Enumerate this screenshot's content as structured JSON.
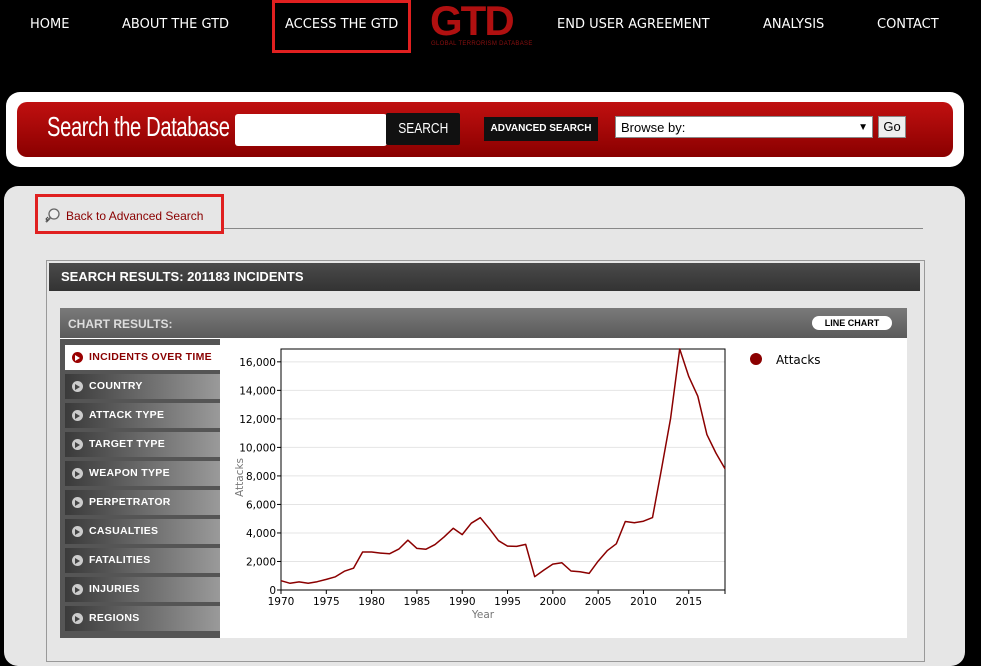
{
  "nav": {
    "items": [
      "HOME",
      "ABOUT THE GTD",
      "ACCESS THE GTD",
      "END USER AGREEMENT",
      "ANALYSIS",
      "CONTACT"
    ],
    "logo_text": "GTD",
    "logo_subtitle": "GLOBAL TERRORISM DATABASE"
  },
  "search": {
    "title": "Search the Database",
    "input_value": "",
    "search_label": "SEARCH",
    "advanced_label": "ADVANCED SEARCH",
    "browse_selected": "Browse by:",
    "go_label": "Go"
  },
  "back_link": "Back to Advanced Search",
  "results": {
    "header": "SEARCH RESULTS: 201183 INCIDENTS",
    "chart_header": "CHART RESULTS:",
    "chart_type_button": "LINE CHART",
    "categories": [
      "INCIDENTS OVER TIME",
      "COUNTRY",
      "ATTACK TYPE",
      "TARGET TYPE",
      "WEAPON TYPE",
      "PERPETRATOR",
      "CASUALTIES",
      "FATALITIES",
      "INJURIES",
      "REGIONS"
    ],
    "active_category": "INCIDENTS OVER TIME"
  },
  "colors": {
    "accent": "#8a0000",
    "line": "#8b0000",
    "nav_active_outline": "#e02020"
  },
  "chart_data": {
    "type": "line",
    "xlabel": "Year",
    "ylabel": "Attacks",
    "xlim": [
      1970,
      2019
    ],
    "ylim": [
      0,
      16900
    ],
    "xticks": [
      1970,
      1975,
      1980,
      1985,
      1990,
      1995,
      2000,
      2005,
      2010,
      2015
    ],
    "yticks": [
      0,
      2000,
      4000,
      6000,
      8000,
      10000,
      12000,
      14000,
      16000
    ],
    "ytick_labels": [
      "0",
      "2,000",
      "4,000",
      "6,000",
      "8,000",
      "10,000",
      "12,000",
      "14,000",
      "16,000"
    ],
    "legend_position": "top-right",
    "series": [
      {
        "name": "Attacks",
        "x": [
          1970,
          1971,
          1972,
          1973,
          1974,
          1975,
          1976,
          1977,
          1978,
          1979,
          1980,
          1981,
          1982,
          1983,
          1984,
          1985,
          1986,
          1987,
          1988,
          1989,
          1990,
          1991,
          1992,
          1993,
          1994,
          1995,
          1996,
          1997,
          1998,
          1999,
          2000,
          2001,
          2002,
          2003,
          2004,
          2005,
          2006,
          2007,
          2008,
          2009,
          2010,
          2011,
          2012,
          2013,
          2014,
          2015,
          2016,
          2017,
          2018,
          2019
        ],
        "values": [
          651,
          471,
          568,
          473,
          581,
          740,
          923,
          1319,
          1526,
          2662,
          2662,
          2586,
          2544,
          2870,
          3495,
          2915,
          2860,
          3183,
          3721,
          4324,
          3887,
          4683,
          5071,
          4300,
          3456,
          3081,
          3058,
          3197,
          934,
          1395,
          1814,
          1906,
          1333,
          1278,
          1166,
          2017,
          2758,
          3242,
          4805,
          4721,
          4826,
          5076,
          8522,
          12036,
          16903,
          14965,
          13587,
          10900,
          9607,
          8500
        ]
      }
    ]
  }
}
